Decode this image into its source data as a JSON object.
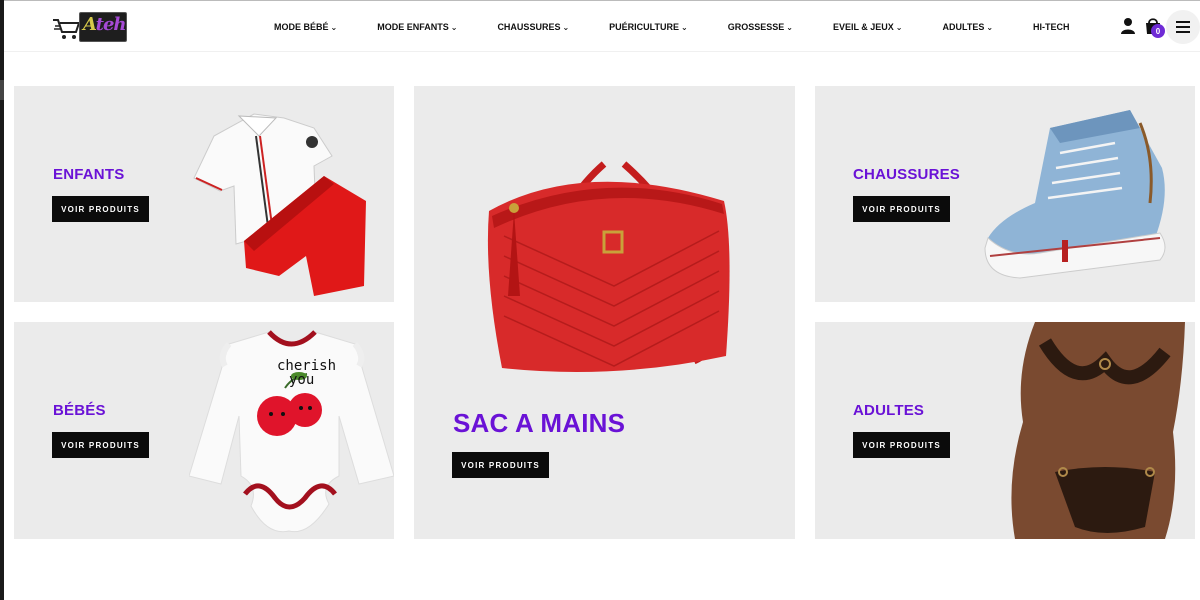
{
  "header": {
    "logo_text": "Ateh",
    "nav": [
      {
        "label": "MODE BÉBÉ",
        "dropdown": true
      },
      {
        "label": "MODE ENFANTS",
        "dropdown": true
      },
      {
        "label": "CHAUSSURES",
        "dropdown": true
      },
      {
        "label": "PUÉRICULTURE",
        "dropdown": true
      },
      {
        "label": "GROSSESSE",
        "dropdown": true
      },
      {
        "label": "EVEIL & JEUX",
        "dropdown": true
      },
      {
        "label": "ADULTES",
        "dropdown": true
      },
      {
        "label": "HI-TECH",
        "dropdown": false
      }
    ],
    "cart_count": "0",
    "icons": [
      "shopping-cart-logo-icon",
      "user-icon",
      "shopping-bag-icon",
      "hamburger-menu-icon"
    ]
  },
  "tiles": {
    "enfants": {
      "title": "ENFANTS",
      "button": "VOIR PRODUITS"
    },
    "bebes": {
      "title": "BÉBÉS",
      "button": "VOIR PRODUITS"
    },
    "sac": {
      "title": "SAC A MAINS",
      "button": "VOIR PRODUITS"
    },
    "chaussures": {
      "title": "CHAUSSURES",
      "button": "VOIR PRODUITS"
    },
    "adultes": {
      "title": "ADULTES",
      "button": "VOIR PRODUITS"
    }
  },
  "onesie_print": {
    "line1": "cherish",
    "line2": "you"
  },
  "colors": {
    "accent": "#6a12d6",
    "tile_bg": "#ebebeb",
    "button_bg": "#0b0b0b",
    "badge": "#6f2bd6",
    "bag_red": "#d82a2a"
  }
}
